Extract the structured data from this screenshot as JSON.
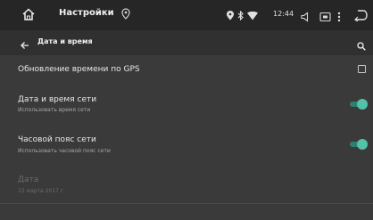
{
  "status_bar": {
    "title": "Настройки",
    "time": "12:44",
    "icons": [
      "home-icon",
      "location-icon",
      "bluetooth-icon",
      "wifi-icon",
      "volume-icon",
      "screenshot-icon",
      "menu-icon",
      "back-icon"
    ]
  },
  "action_bar": {
    "title": "Дата и время",
    "icons": [
      "back-arrow-icon",
      "search-icon"
    ]
  },
  "settings": {
    "gps_time": {
      "title": "Обновление времени по GPS",
      "checked": false
    },
    "network_time": {
      "title": "Дата и время сети",
      "subtitle": "Использовать время сети",
      "enabled": true
    },
    "network_timezone": {
      "title": "Часовой пояс сети",
      "subtitle": "Использовать часовой пояс сети",
      "enabled": true
    },
    "date": {
      "title": "Дата",
      "subtitle": "15 марта 2017 г.",
      "disabled": true
    }
  },
  "colors": {
    "accent": "#53c2a8",
    "background": "#3a3a3a",
    "status_bar": "#262626"
  }
}
